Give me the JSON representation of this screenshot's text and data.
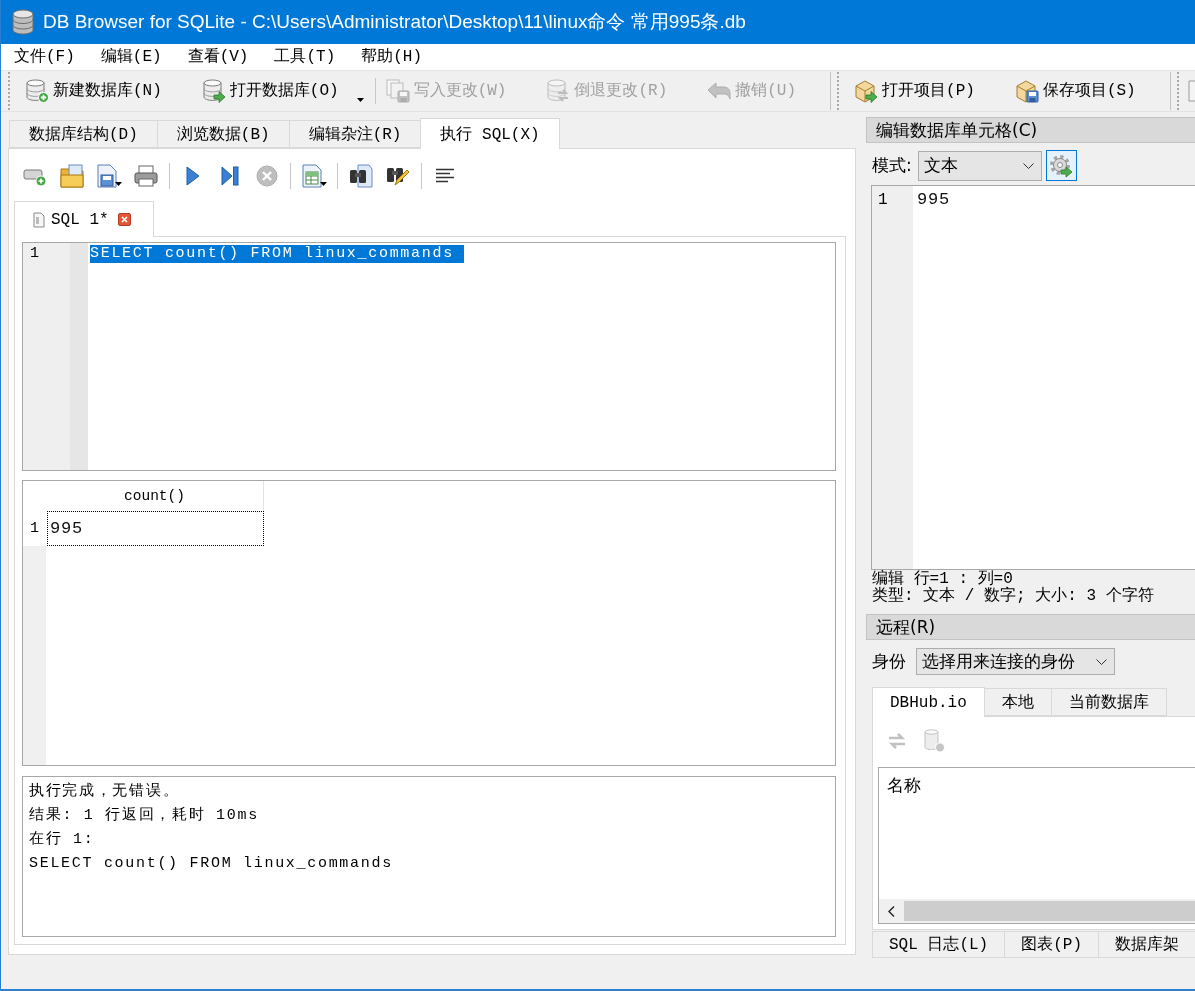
{
  "window": {
    "title": "DB Browser for SQLite - C:\\Users\\Administrator\\Desktop\\11\\linux命令 常用995条.db"
  },
  "menu": [
    "文件(F)",
    "编辑(E)",
    "查看(V)",
    "工具(T)",
    "帮助(H)"
  ],
  "toolbars": [
    {
      "items": [
        {
          "kind": "button",
          "label": "新建数据库(N)",
          "disabled": false,
          "dropdown": false
        },
        {
          "kind": "button",
          "label": "打开数据库(O)",
          "disabled": false,
          "dropdown": true
        },
        {
          "kind": "separator"
        },
        {
          "kind": "button",
          "label": "写入更改(W)",
          "disabled": true,
          "dropdown": false
        },
        {
          "kind": "button",
          "label": "倒退更改(R)",
          "disabled": true,
          "dropdown": false
        },
        {
          "kind": "button",
          "label": "撤销(U)",
          "disabled": true,
          "dropdown": false
        }
      ]
    },
    {
      "items": [
        {
          "kind": "button",
          "label": "打开项目(P)",
          "disabled": false,
          "dropdown": false
        },
        {
          "kind": "button",
          "label": "保存项目(S)",
          "disabled": false,
          "dropdown": false
        }
      ]
    },
    {
      "items": [
        {
          "kind": "button",
          "disabled": false,
          "dropdown": false
        }
      ]
    }
  ],
  "main_tabs": [
    {
      "label": "数据库结构(D)",
      "selected": false
    },
    {
      "label": "浏览数据(B)",
      "selected": false
    },
    {
      "label": "编辑杂注(R)",
      "selected": false
    },
    {
      "label": "执行 SQL(X)",
      "selected": true
    }
  ],
  "sql_toolbar": [
    {
      "kind": "button",
      "disabled": false,
      "dropdown": false
    },
    {
      "kind": "button",
      "disabled": false,
      "dropdown": false
    },
    {
      "kind": "button",
      "disabled": false,
      "dropdown": true
    },
    {
      "kind": "button",
      "disabled": false,
      "dropdown": false
    },
    {
      "kind": "separator"
    },
    {
      "kind": "button",
      "disabled": false,
      "dropdown": false
    },
    {
      "kind": "button",
      "disabled": false,
      "dropdown": false
    },
    {
      "kind": "button",
      "disabled": true,
      "dropdown": false
    },
    {
      "kind": "separator"
    },
    {
      "kind": "button",
      "disabled": false,
      "dropdown": true
    },
    {
      "kind": "separator"
    },
    {
      "kind": "button",
      "disabled": false,
      "dropdown": false
    },
    {
      "kind": "button",
      "disabled": false,
      "dropdown": false
    },
    {
      "kind": "separator"
    },
    {
      "kind": "button",
      "disabled": false,
      "dropdown": false
    }
  ],
  "editor_tabs": [
    {
      "label": "SQL 1*",
      "selected": true
    }
  ],
  "sql_editor": {
    "lines": [
      {
        "number": "1",
        "text": "SELECT count() FROM linux_commands",
        "selected": true
      }
    ]
  },
  "results": {
    "columns": [
      "count()"
    ],
    "rows": [
      {
        "number": "1",
        "cells": [
          {
            "text": "995",
            "focused": true
          }
        ]
      }
    ]
  },
  "messages": [
    "执行完成，无错误。",
    "结果: 1 行返回，耗时 10ms",
    "在行 1:",
    "SELECT count() FROM linux_commands"
  ],
  "edit_cell": {
    "title": "编辑数据库单元格(C)",
    "mode_label": "模式:",
    "mode": "文本",
    "lines": [
      {
        "number": "1",
        "text": "995"
      }
    ],
    "status": [
      "编辑 行=1 : 列=0",
      "类型: 文本 / 数字; 大小: 3 个字符"
    ]
  },
  "remote": {
    "title": "远程(R)",
    "identity_label": "身份",
    "identity": "选择用来连接的身份",
    "tabs": [
      {
        "label": "DBHub.io",
        "selected": true
      },
      {
        "label": "本地",
        "selected": false
      },
      {
        "label": "当前数据库",
        "selected": false
      }
    ],
    "toolbar": [
      {
        "disabled": true
      },
      {
        "disabled": true
      }
    ],
    "list_header": "名称"
  },
  "dock_tabs": [
    {
      "label": "SQL 日志(L)",
      "selected": false
    },
    {
      "label": "图表(P)",
      "selected": false
    },
    {
      "label": "数据库架",
      "selected": false
    }
  ]
}
